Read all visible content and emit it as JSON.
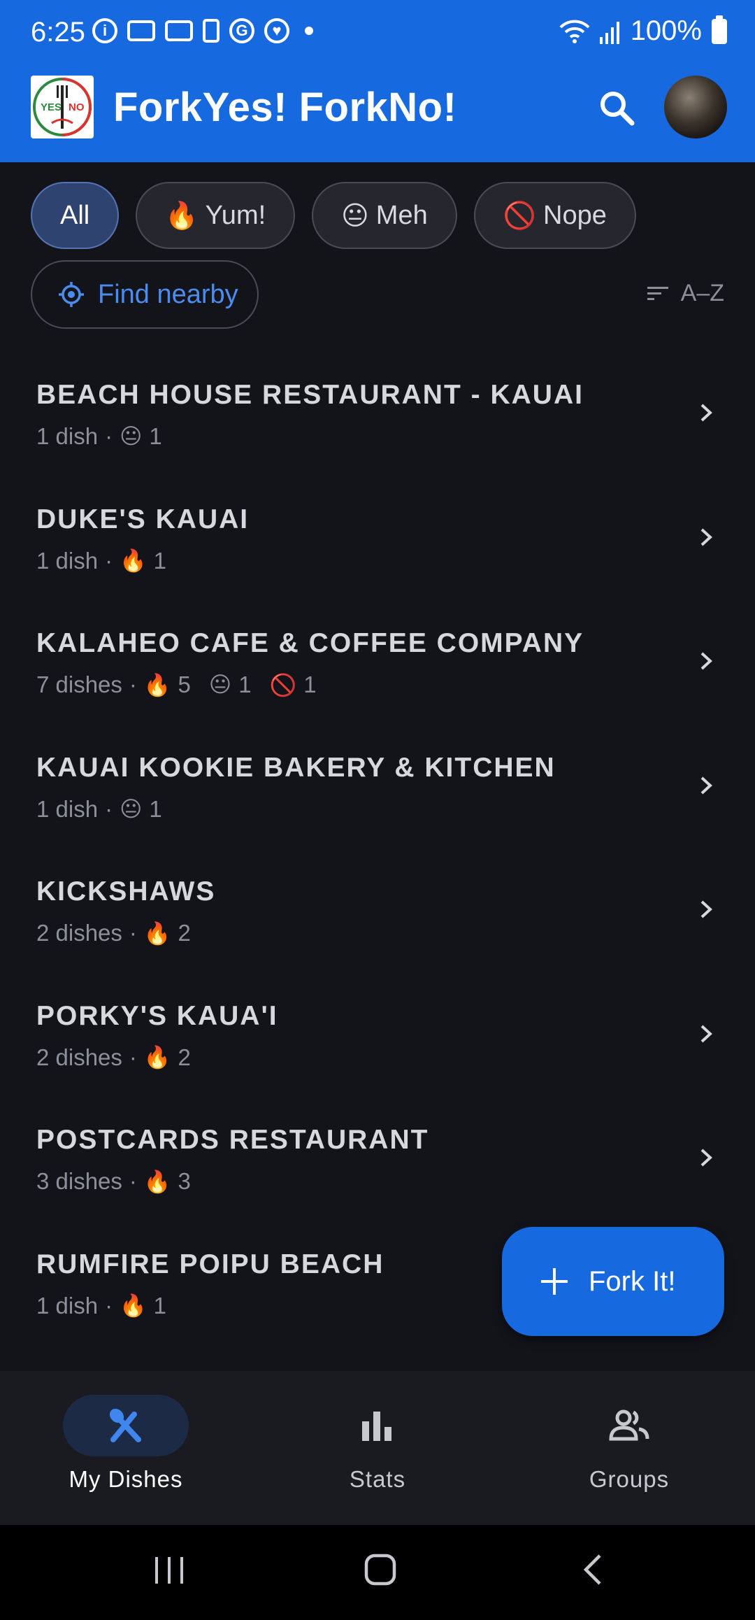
{
  "status_bar": {
    "time": "6:25",
    "battery": "100%"
  },
  "app": {
    "title": "ForkYes! ForkNo!",
    "logo_text_yes": "YES",
    "logo_text_no": "NO"
  },
  "filters": {
    "chips": [
      {
        "label": "All",
        "emoji": "",
        "active": true
      },
      {
        "label": "Yum!",
        "emoji": "🔥",
        "active": false
      },
      {
        "label": "Meh",
        "emoji": "😐",
        "active": false
      },
      {
        "label": "Nope",
        "emoji": "🚫",
        "active": false
      }
    ],
    "find_nearby": "Find nearby",
    "sort_label": "A–Z"
  },
  "restaurants": [
    {
      "name": "BEACH HOUSE RESTAURANT - KAUAI",
      "dishes": "1 dish",
      "ratings": [
        {
          "emoji": "😐",
          "count": "1"
        }
      ]
    },
    {
      "name": "DUKE'S KAUAI",
      "dishes": "1 dish",
      "ratings": [
        {
          "emoji": "🔥",
          "count": "1"
        }
      ]
    },
    {
      "name": "KALAHEO CAFE & COFFEE COMPANY",
      "dishes": "7 dishes",
      "ratings": [
        {
          "emoji": "🔥",
          "count": "5"
        },
        {
          "emoji": "😐",
          "count": "1"
        },
        {
          "emoji": "🚫",
          "count": "1"
        }
      ]
    },
    {
      "name": "KAUAI KOOKIE BAKERY & KITCHEN",
      "dishes": "1 dish",
      "ratings": [
        {
          "emoji": "😐",
          "count": "1"
        }
      ]
    },
    {
      "name": "KICKSHAWS",
      "dishes": "2 dishes",
      "ratings": [
        {
          "emoji": "🔥",
          "count": "2"
        }
      ]
    },
    {
      "name": "PORKY'S KAUA'I",
      "dishes": "2 dishes",
      "ratings": [
        {
          "emoji": "🔥",
          "count": "2"
        }
      ]
    },
    {
      "name": "POSTCARDS RESTAURANT",
      "dishes": "3 dishes",
      "ratings": [
        {
          "emoji": "🔥",
          "count": "3"
        }
      ]
    },
    {
      "name": "RUMFIRE POIPU BEACH",
      "dishes": "1 dish",
      "ratings": [
        {
          "emoji": "🔥",
          "count": "1"
        }
      ]
    }
  ],
  "fab": {
    "label": "Fork It!"
  },
  "bottom_nav": [
    {
      "label": "My Dishes",
      "icon": "fork-knife-icon",
      "active": true
    },
    {
      "label": "Stats",
      "icon": "bar-chart-icon",
      "active": false
    },
    {
      "label": "Groups",
      "icon": "people-icon",
      "active": false
    }
  ],
  "colors": {
    "primary": "#1769e0",
    "background": "#13141a",
    "chip_active": "#2e4370",
    "link": "#4a8cf0"
  }
}
